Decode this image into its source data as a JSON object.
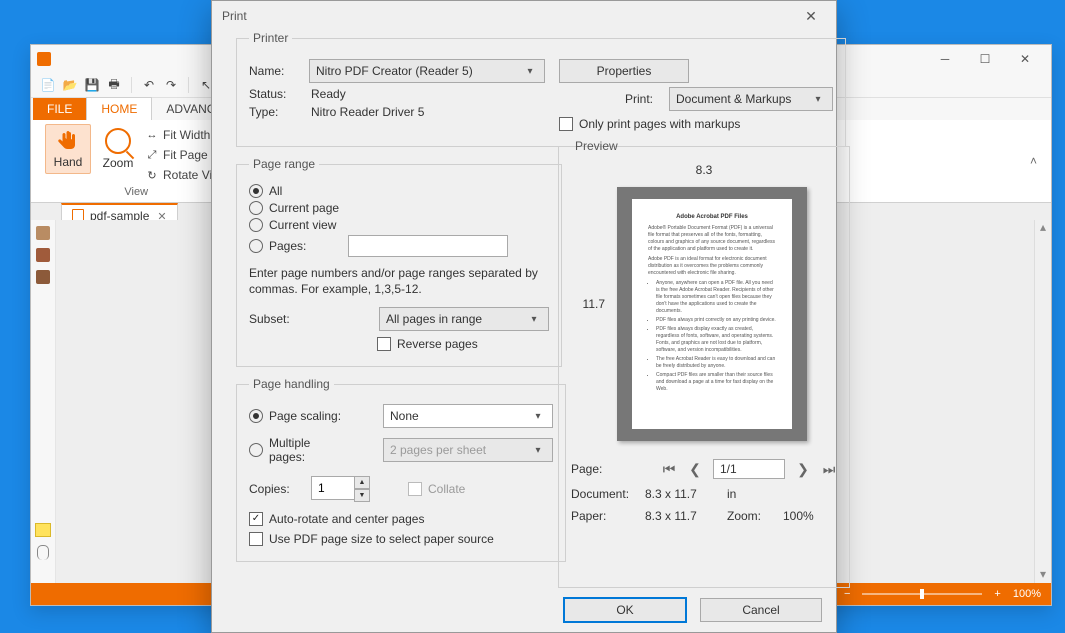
{
  "app": {
    "tabs": {
      "file": "FILE",
      "home": "HOME",
      "advanced": "ADVANCE"
    },
    "ribbon": {
      "hand": "Hand",
      "zoom": "Zoom",
      "fit_width": "Fit Width",
      "fit_page": "Fit Page",
      "rotate": "Rotate View",
      "group": "View"
    },
    "doc_tab": "pdf-sample",
    "status": {
      "zoom": "100%"
    }
  },
  "dialog": {
    "title": "Print",
    "printer": {
      "legend": "Printer",
      "name_label": "Name:",
      "name_value": "Nitro PDF Creator (Reader 5)",
      "properties": "Properties",
      "status_label": "Status:",
      "status_value": "Ready",
      "type_label": "Type:",
      "type_value": "Nitro Reader Driver 5",
      "print_label": "Print:",
      "print_value": "Document & Markups",
      "only_markups": "Only print pages with markups"
    },
    "range": {
      "legend": "Page range",
      "all": "All",
      "current_page": "Current page",
      "current_view": "Current view",
      "pages": "Pages:",
      "hint": "Enter page numbers and/or page ranges separated by commas. For example, 1,3,5-12.",
      "subset_label": "Subset:",
      "subset_value": "All pages in range",
      "reverse": "Reverse pages"
    },
    "handling": {
      "legend": "Page handling",
      "scaling_label": "Page scaling:",
      "scaling_value": "None",
      "multi_label": "Multiple pages:",
      "multi_value": "2 pages per sheet",
      "copies_label": "Copies:",
      "copies_value": "1",
      "collate": "Collate",
      "autorotate": "Auto-rotate and center pages",
      "use_pdf_size": "Use PDF page size to select paper source"
    },
    "preview": {
      "legend": "Preview",
      "width": "8.3",
      "height": "11.7",
      "doc_title": "Adobe Acrobat PDF Files",
      "page_label": "Page:",
      "page_value": "1/1",
      "document_label": "Document:",
      "document_value": "8.3 x 11.7",
      "unit": "in",
      "paper_label": "Paper:",
      "paper_value": "8.3 x 11.7",
      "zoom_label": "Zoom:",
      "zoom_value": "100%"
    },
    "ok": "OK",
    "cancel": "Cancel"
  }
}
